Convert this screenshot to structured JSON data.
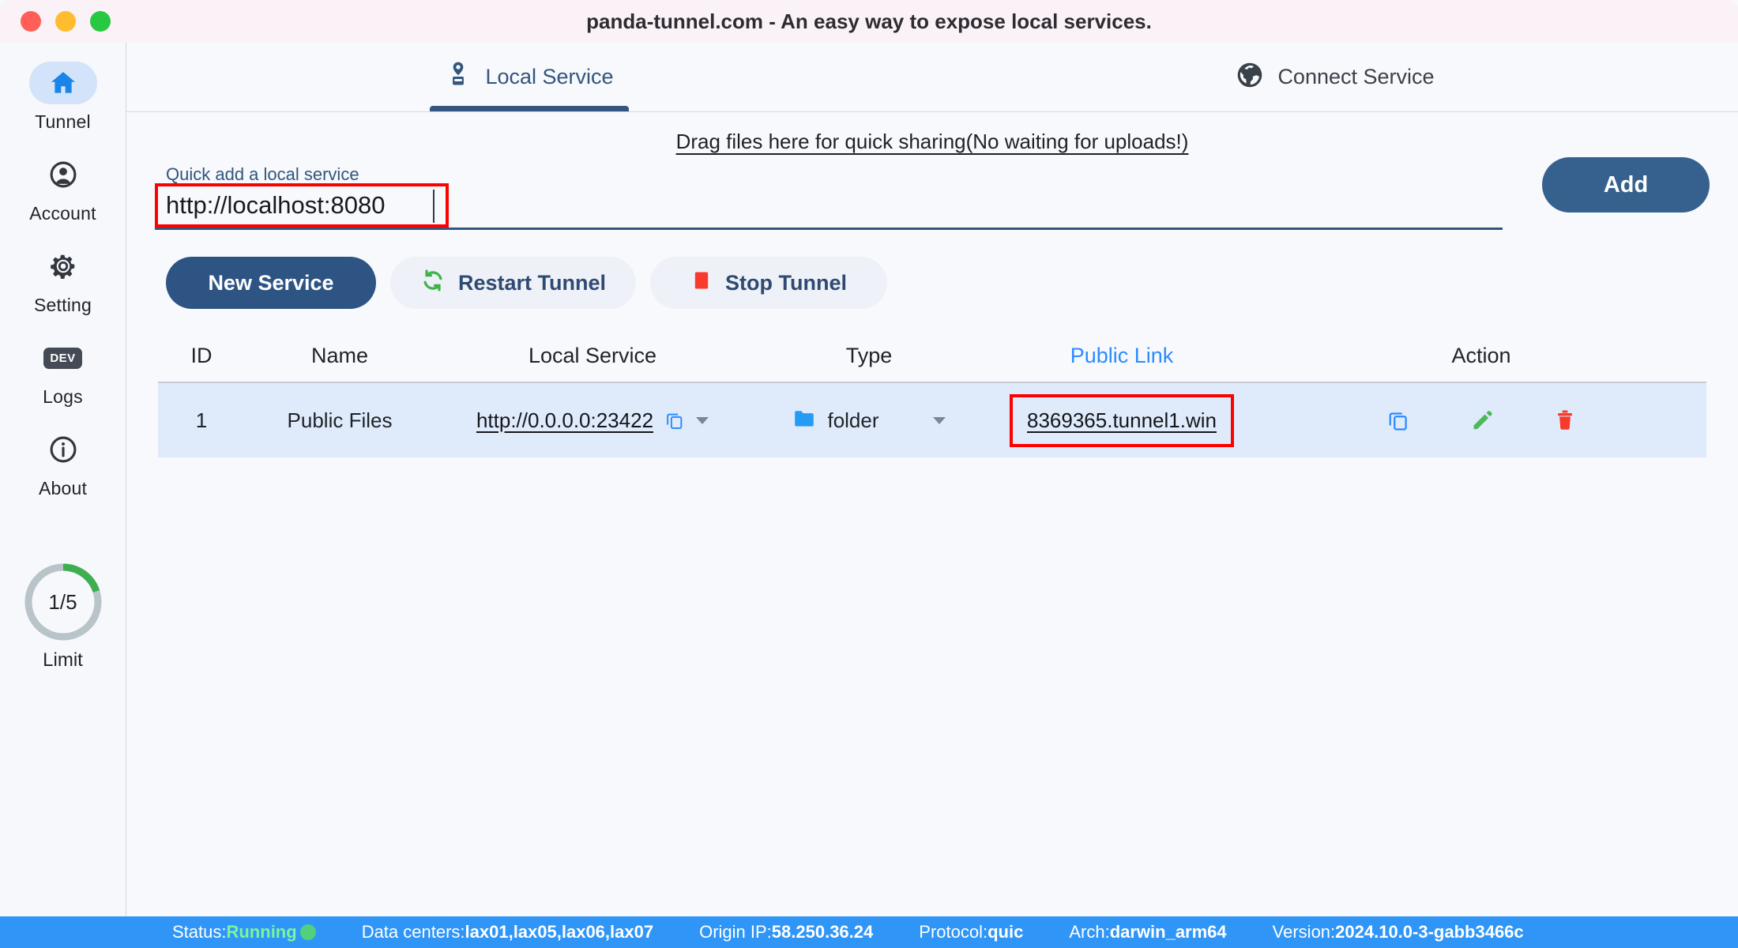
{
  "window": {
    "title": "panda-tunnel.com - An easy way to expose local services.",
    "traffic_lights": [
      "close",
      "minimize",
      "zoom"
    ]
  },
  "sidebar": {
    "items": [
      {
        "label": "Tunnel",
        "icon": "home-icon",
        "active": true
      },
      {
        "label": "Account",
        "icon": "account-icon",
        "active": false
      },
      {
        "label": "Setting",
        "icon": "gear-icon",
        "active": false
      },
      {
        "label": "Logs",
        "icon": "dev-badge-icon",
        "badge": "DEV",
        "active": false
      },
      {
        "label": "About",
        "icon": "info-icon",
        "active": false
      }
    ],
    "limit": {
      "value": "1/5",
      "label": "Limit",
      "used": 1,
      "total": 5,
      "arc_color": "#3eae4f",
      "track_color": "#b8c4c8"
    }
  },
  "tabs": [
    {
      "label": "Local Service",
      "icon": "pin-stamp-icon",
      "active": true
    },
    {
      "label": "Connect Service",
      "icon": "globe-icon",
      "active": false
    }
  ],
  "main": {
    "drag_hint": "Drag files here for quick sharing(No waiting for uploads!)",
    "quick_add": {
      "label": "Quick add a local service",
      "value": "http://localhost:8080",
      "placeholder": "http://localhost:8080",
      "add_label": "Add",
      "highlight_color": "#ff0000"
    },
    "buttons": [
      {
        "label": "New Service",
        "style": "primary",
        "icon": null
      },
      {
        "label": "Restart Tunnel",
        "style": "ghost",
        "icon": "refresh-icon"
      },
      {
        "label": "Stop Tunnel",
        "style": "ghost",
        "icon": "stop-square-icon"
      }
    ],
    "table": {
      "columns": [
        "ID",
        "Name",
        "Local Service",
        "Type",
        "Public Link",
        "Action"
      ],
      "public_link_color": "#2b8bff",
      "rows": [
        {
          "id": "1",
          "name": "Public Files",
          "local_service": "http://0.0.0.0:23422",
          "type": "folder",
          "public_link": "8369365.tunnel1.win",
          "actions": [
            "copy-icon",
            "edit-icon",
            "delete-icon"
          ]
        }
      ]
    }
  },
  "statusbar": {
    "status_key": "Status:",
    "status_value": "Running",
    "items": [
      {
        "key": "Data centers:",
        "value": "lax01,lax05,lax06,lax07"
      },
      {
        "key": "Origin IP:",
        "value": "58.250.36.24"
      },
      {
        "key": "Protocol:",
        "value": "quic"
      },
      {
        "key": "Arch:",
        "value": "darwin_arm64"
      },
      {
        "key": "Version:",
        "value": "2024.10.0-3-gabb3466c"
      }
    ]
  }
}
